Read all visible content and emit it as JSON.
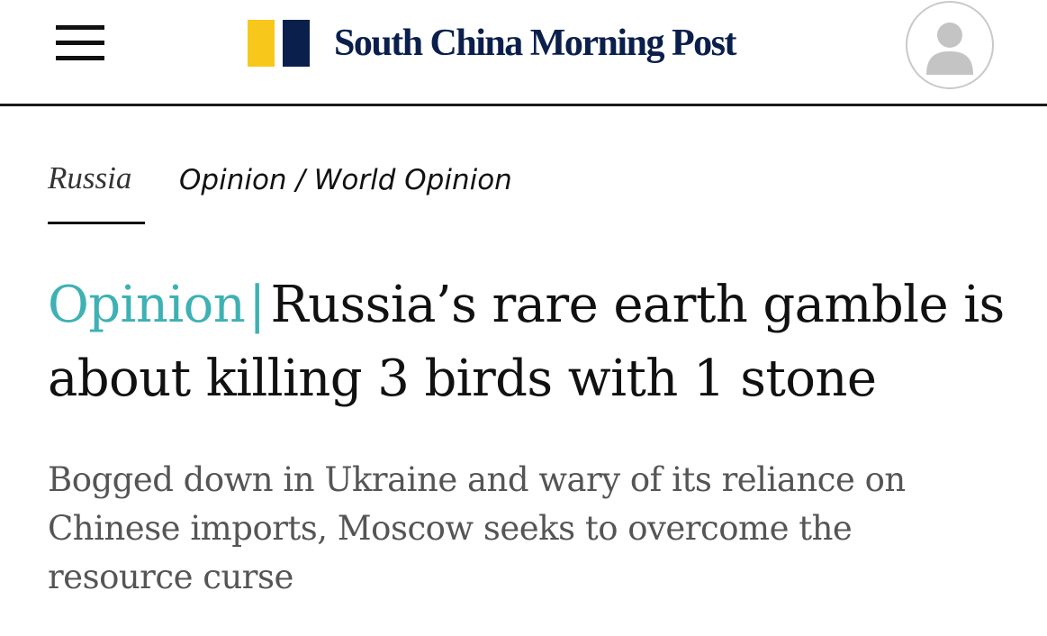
{
  "header": {
    "menu_icon": "hamburger-menu-icon",
    "brand_name": "South China Morning Post",
    "avatar_icon": "user-avatar-icon"
  },
  "breadcrumb": {
    "topic": "Russia",
    "section": "Opinion",
    "separator": "/",
    "subsection": "World Opinion"
  },
  "article": {
    "label": "Opinion",
    "label_separator": "|",
    "title": "Russia’s rare earth gamble is about killing 3 birds with 1 stone",
    "summary": "Bogged down in Ukraine and wary of its reliance on Chinese imports, Moscow seeks to overcome the resource curse"
  },
  "colors": {
    "brand_yellow": "#f7c71b",
    "brand_navy": "#0b1f4d",
    "opinion_accent": "#3eb1b4",
    "summary_text": "#555555"
  }
}
